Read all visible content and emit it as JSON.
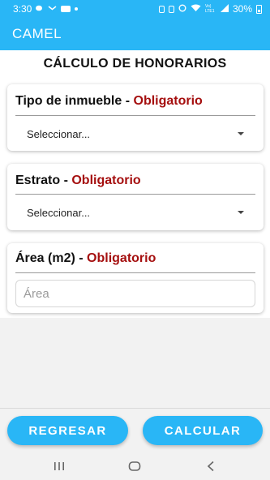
{
  "status_bar": {
    "time": "3:30",
    "signal": "Vo) LTE1",
    "battery": "30%"
  },
  "app_bar": {
    "title": "CAMEL"
  },
  "page": {
    "title": "CÁLCULO DE HONORARIOS"
  },
  "form": {
    "required_label": "Obligatorio",
    "separator": " - ",
    "tipo_inmueble": {
      "label": "Tipo de inmueble",
      "selected": "Seleccionar..."
    },
    "estrato": {
      "label": "Estrato",
      "selected": "Seleccionar..."
    },
    "area": {
      "label": "Área (m2)",
      "value": "",
      "placeholder": "Área"
    }
  },
  "actions": {
    "back_label": "REGRESAR",
    "calculate_label": "CALCULAR"
  },
  "colors": {
    "accent": "#29b6f6",
    "required": "#a50f0f",
    "background": "#f2f2f2"
  },
  "icons": {
    "status": [
      "wechat-icon",
      "mail-icon",
      "youtube-icon",
      "dot-icon",
      "camera-icon",
      "security-icon",
      "alarm-icon",
      "wifi-icon",
      "signal-icon",
      "battery-icon"
    ],
    "nav": [
      "recent-apps-icon",
      "home-icon",
      "back-icon"
    ]
  }
}
